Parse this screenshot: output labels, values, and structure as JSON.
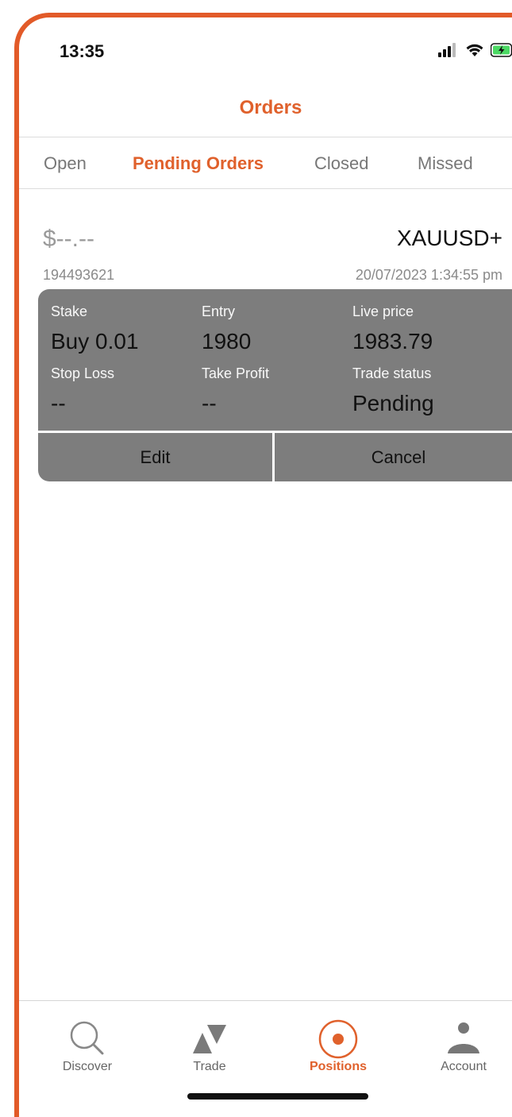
{
  "status_bar": {
    "time": "13:35",
    "icons": [
      "signal-icon",
      "wifi-icon",
      "battery-charging-icon"
    ]
  },
  "nav": {
    "title": "Orders"
  },
  "tabs": [
    {
      "label": "Open",
      "active": false
    },
    {
      "label": "Pending Orders",
      "active": true
    },
    {
      "label": "Closed",
      "active": false
    },
    {
      "label": "Missed",
      "active": false
    }
  ],
  "order": {
    "pnl": "$--.--",
    "symbol": "XAUUSD+",
    "id": "194493621",
    "datetime": "20/07/2023 1:34:55 pm",
    "fields": {
      "stake_label": "Stake",
      "stake_value": "Buy 0.01",
      "entry_label": "Entry",
      "entry_value": "1980",
      "live_price_label": "Live price",
      "live_price_value": "1983.79",
      "stop_loss_label": "Stop Loss",
      "stop_loss_value": "--",
      "take_profit_label": "Take Profit",
      "take_profit_value": "--",
      "trade_status_label": "Trade status",
      "trade_status_value": "Pending"
    },
    "actions": {
      "edit_label": "Edit",
      "cancel_label": "Cancel"
    }
  },
  "tab_bar": [
    {
      "label": "Discover",
      "icon": "search-icon",
      "active": false
    },
    {
      "label": "Trade",
      "icon": "trade-arrows-icon",
      "active": false
    },
    {
      "label": "Positions",
      "icon": "positions-target-icon",
      "active": true
    },
    {
      "label": "Account",
      "icon": "user-icon",
      "active": false
    }
  ],
  "colors": {
    "accent": "#e0612c",
    "card": "#7d7d7d",
    "inactive_text": "#777777"
  }
}
